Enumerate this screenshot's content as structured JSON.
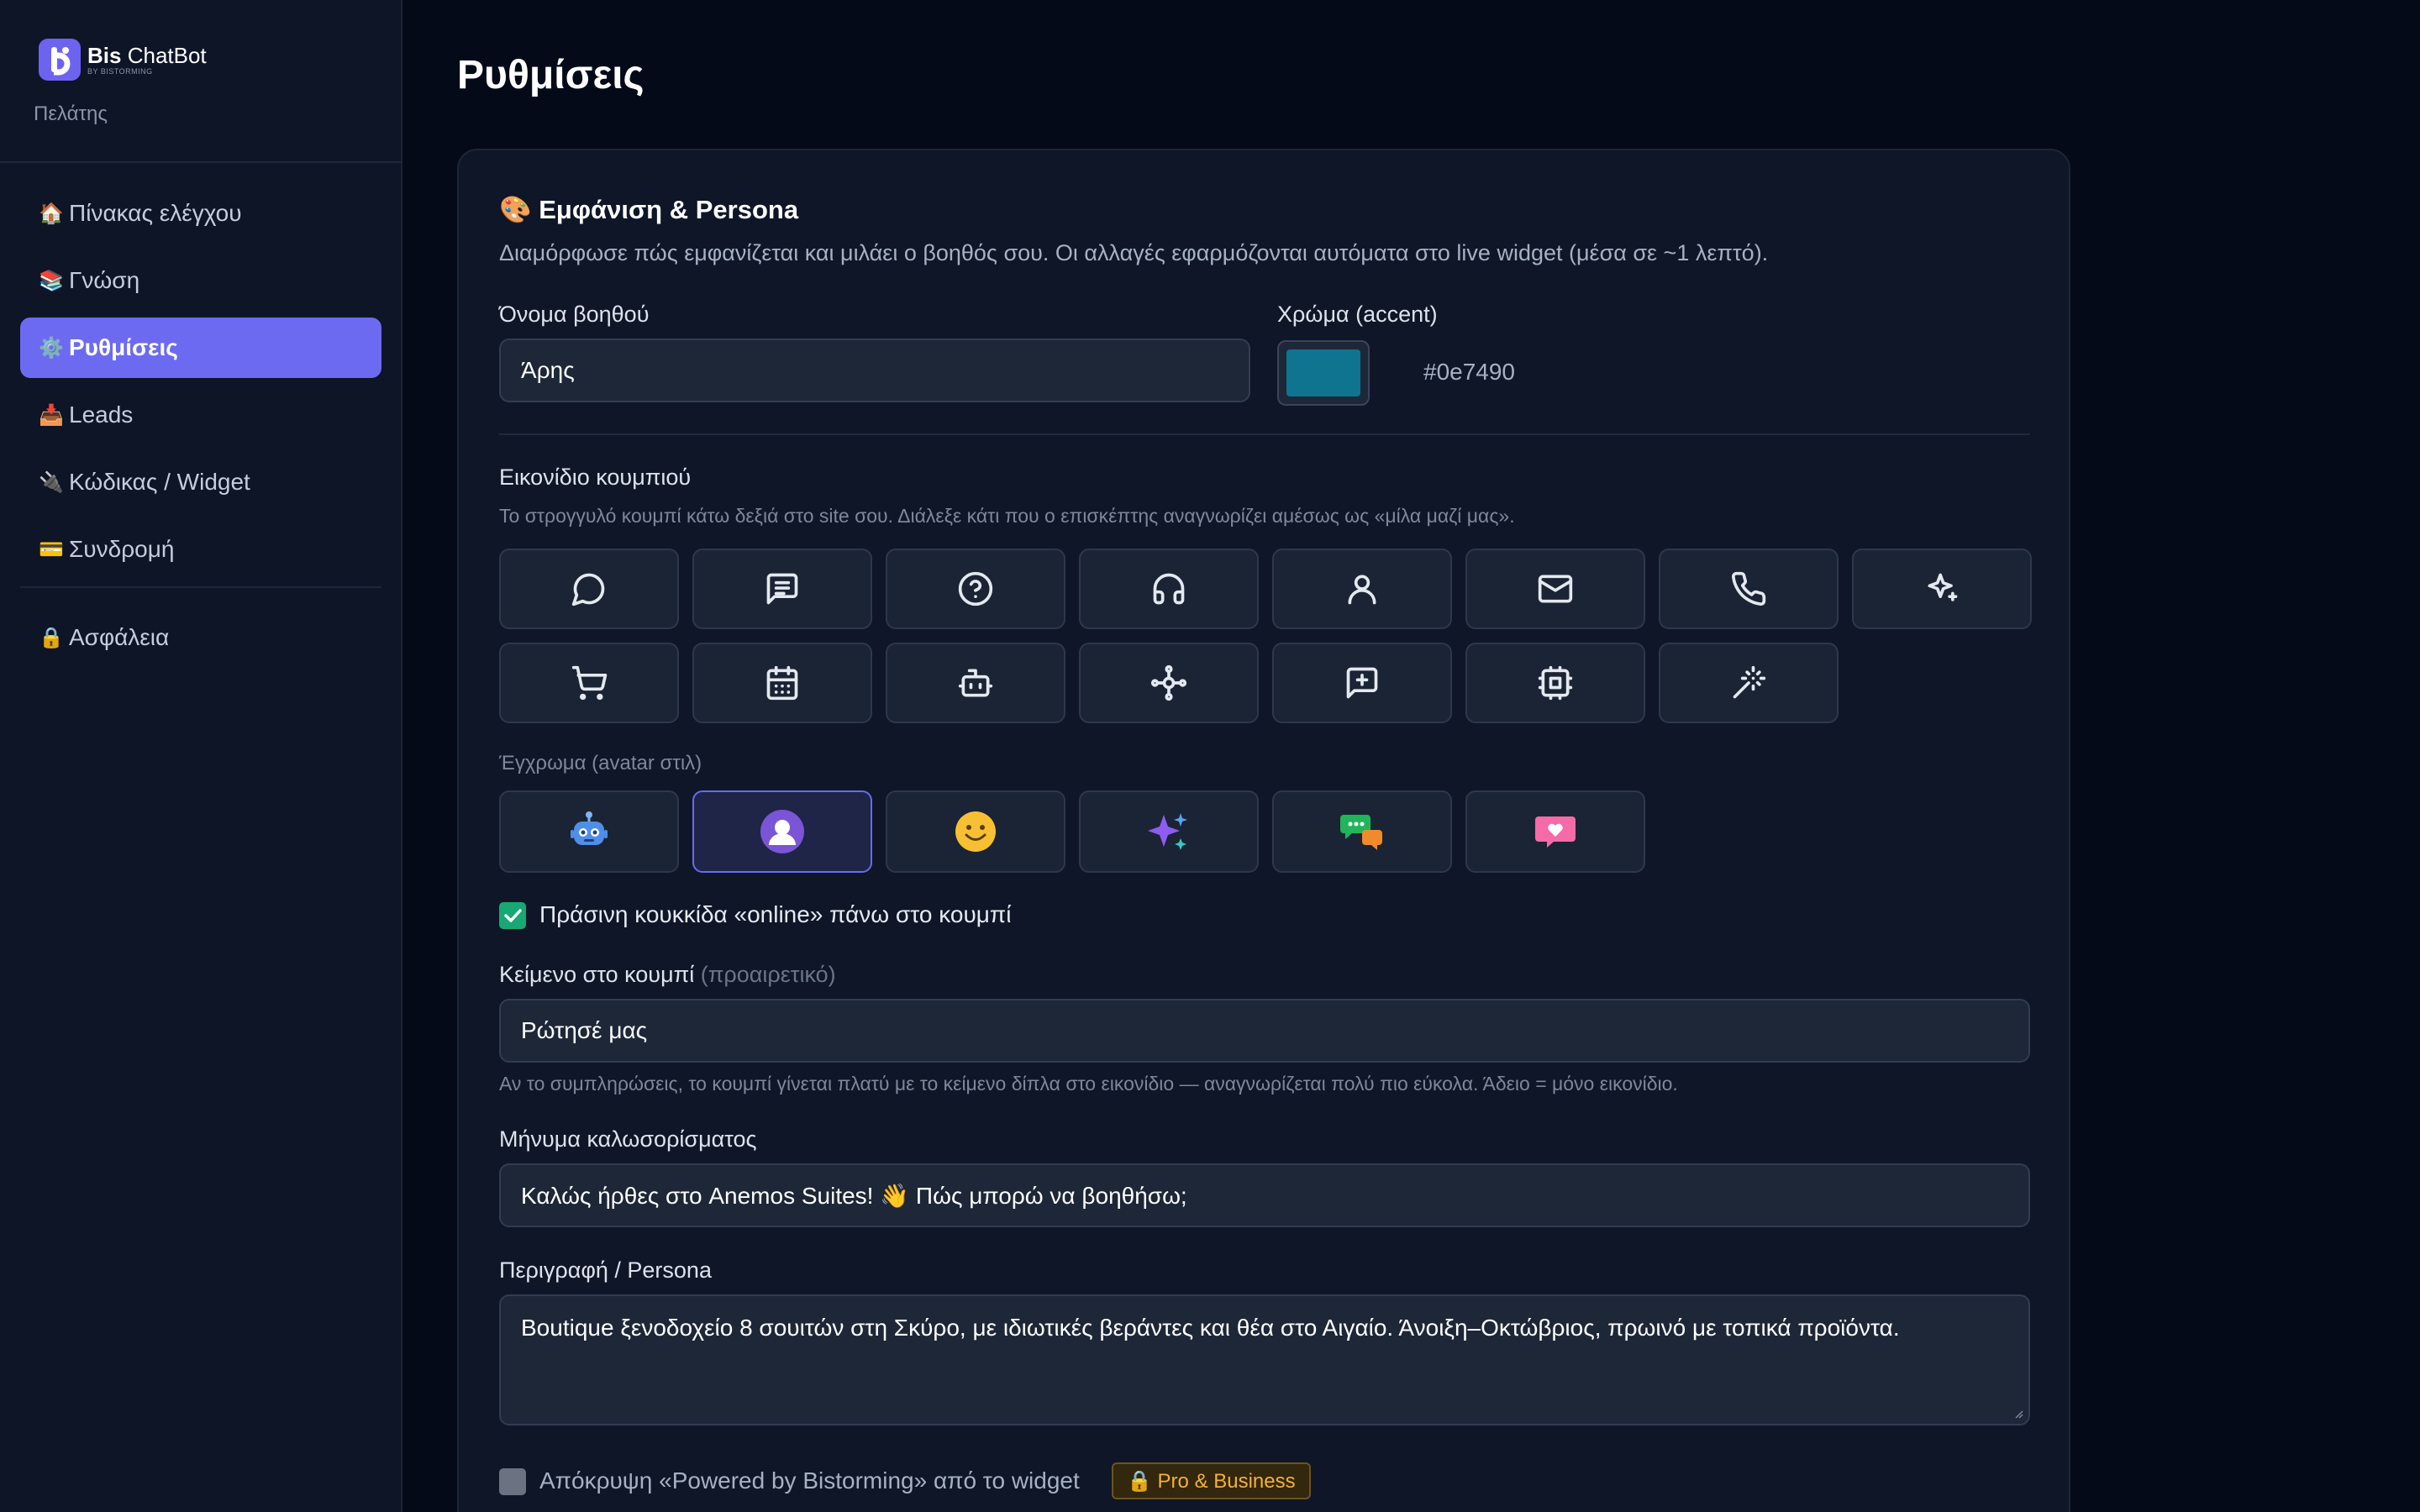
{
  "sidebar": {
    "brand_bold": "Bis",
    "brand_rest": "ChatBot",
    "brand_tag": "BY BISTORMING",
    "subtitle": "Πελάτης",
    "items": [
      {
        "emoji": "🏠",
        "label": "Πίνακας ελέγχου",
        "active": false
      },
      {
        "emoji": "📚",
        "label": "Γνώση",
        "active": false
      },
      {
        "emoji": "⚙️",
        "label": "Ρυθμίσεις",
        "active": true
      },
      {
        "emoji": "📥",
        "label": "Leads",
        "active": false
      },
      {
        "emoji": "🔌",
        "label": "Κώδικας / Widget",
        "active": false
      },
      {
        "emoji": "💳",
        "label": "Συνδρομή",
        "active": false
      }
    ],
    "security": {
      "emoji": "🔒",
      "label": "Ασφάλεια"
    }
  },
  "page_title": "Ρυθμίσεις",
  "appearance": {
    "title_emoji": "🎨",
    "title": "Εμφάνιση & Persona",
    "description": "Διαμόρφωσε πώς εμφανίζεται και μιλάει ο βοηθός σου. Οι αλλαγές εφαρμόζονται αυτόματα στο live widget (μέσα σε ~1 λεπτό).",
    "name_label": "Όνομα βοηθού",
    "name_value": "Άρης",
    "color_label": "Χρώμα (accent)",
    "color_value": "#0e7490",
    "icon_label": "Εικονίδιο κουμπιού",
    "icon_hint": "Το στρογγυλό κουμπί κάτω δεξιά στο site σου. Διάλεξε κάτι που ο επισκέπτης αναγνωρίζει αμέσως ως «μίλα μαζί μας».",
    "icons": [
      "message-circle-icon",
      "message-square-text-icon",
      "help-circle-icon",
      "headphones-icon",
      "user-icon",
      "mail-icon",
      "phone-icon",
      "sparkles-icon",
      "shopping-cart-icon",
      "calendar-icon",
      "bot-icon",
      "network-icon",
      "message-plus-icon",
      "cpu-icon",
      "magic-wand-icon"
    ],
    "colored_label": "Έγχρωμα (avatar στιλ)",
    "colored_icons": [
      "robot-avatar-icon",
      "person-avatar-icon",
      "smiley-avatar-icon",
      "sparkles-avatar-icon",
      "chat-bubbles-avatar-icon",
      "heart-message-avatar-icon"
    ],
    "selected_colored_index": 1,
    "online_dot_label": "Πράσινη κουκκίδα «online» πάνω στο κουμπί",
    "online_dot_checked": true,
    "button_text_label": "Κείμενο στο κουμπί",
    "button_text_optional": "(προαιρετικό)",
    "button_text_value": "Ρώτησέ μας",
    "button_text_hint": "Αν το συμπληρώσεις, το κουμπί γίνεται πλατύ με το κείμενο δίπλα στο εικονίδιο — αναγνωρίζεται πολύ πιο εύκολα. Άδειο = μόνο εικονίδιο.",
    "welcome_label": "Μήνυμα καλωσορίσματος",
    "welcome_value": "Καλώς ήρθες στο Anemos Suites! 👋 Πώς μπορώ να βοηθήσω;",
    "persona_label": "Περιγραφή / Persona",
    "persona_value": "Boutique ξενοδοχείο 8 σουιτών στη Σκύρο, με ιδιωτικές βεράντες και θέα στο Αιγαίο. Άνοιξη–Οκτώβριος, πρωινό με τοπικά προϊόντα.",
    "hide_powered_label": "Απόκρυψη «Powered by Bistorming» από το widget",
    "hide_powered_checked": false,
    "pro_badge": "🔒 Pro & Business"
  },
  "colors": {
    "accent_nav": "#6d6af2",
    "accent_widget": "#0e7490",
    "check_green": "#18a873",
    "badge_gold": "#f2b233"
  }
}
